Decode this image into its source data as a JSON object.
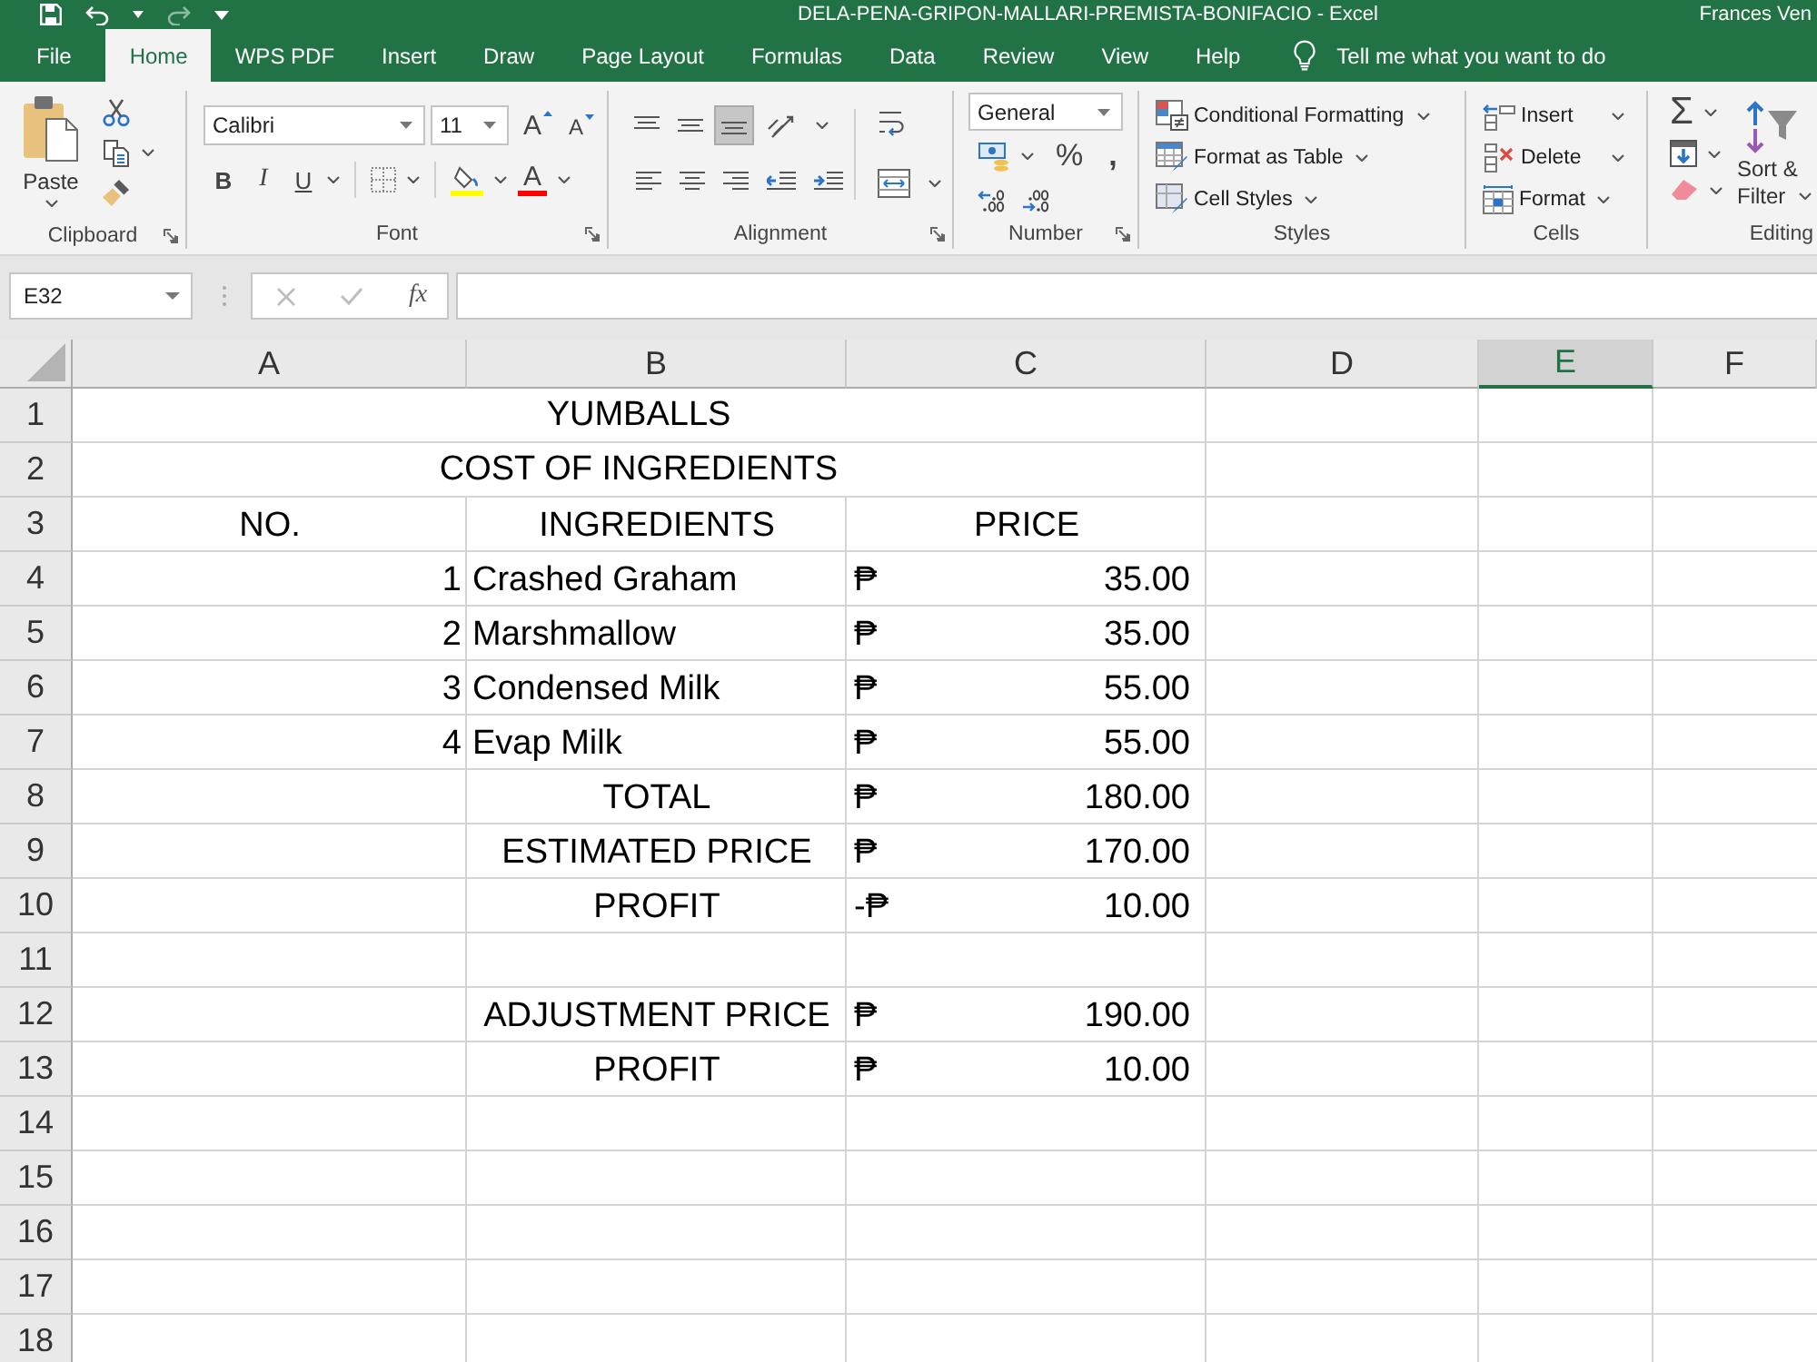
{
  "title_bar": {
    "title": "DELA-PENA-GRIPON-MALLARI-PREMISTA-BONIFACIO  -  Excel",
    "user": "Frances Ven"
  },
  "tabs": [
    {
      "label": "File",
      "selected": false
    },
    {
      "label": "Home",
      "selected": true
    },
    {
      "label": "WPS PDF",
      "selected": false
    },
    {
      "label": "Insert",
      "selected": false
    },
    {
      "label": "Draw",
      "selected": false
    },
    {
      "label": "Page Layout",
      "selected": false
    },
    {
      "label": "Formulas",
      "selected": false
    },
    {
      "label": "Data",
      "selected": false
    },
    {
      "label": "Review",
      "selected": false
    },
    {
      "label": "View",
      "selected": false
    },
    {
      "label": "Help",
      "selected": false
    }
  ],
  "tell_me": "Tell me what you want to do",
  "ribbon": {
    "clipboard": {
      "label": "Clipboard",
      "paste": "Paste"
    },
    "font": {
      "label": "Font",
      "font_name": "Calibri",
      "font_size": "11",
      "grow": "A",
      "shrink": "A",
      "bold": "B",
      "italic": "I",
      "underline": "U",
      "font_color": "A"
    },
    "alignment": {
      "label": "Alignment",
      "vertical": [
        {
          "kind": "top",
          "selected": false
        },
        {
          "kind": "middle",
          "selected": false
        },
        {
          "kind": "bottom",
          "selected": true
        }
      ]
    },
    "number": {
      "label": "Number",
      "format": "General",
      "percent": "%",
      "comma": ","
    },
    "styles": {
      "label": "Styles",
      "items": [
        {
          "kind": "conditional",
          "label": "Conditional Formatting"
        },
        {
          "kind": "table",
          "label": "Format as Table"
        },
        {
          "kind": "cell_styles",
          "label": "Cell Styles"
        }
      ]
    },
    "cells": {
      "label": "Cells",
      "items": [
        {
          "kind": "insert",
          "label": "Insert"
        },
        {
          "kind": "delete",
          "label": "Delete"
        },
        {
          "kind": "format",
          "label": "Format"
        }
      ]
    },
    "editing": {
      "label": "Editing",
      "autosum": "Σ",
      "sort_filter": [
        "Sort &",
        "Filter"
      ]
    }
  },
  "formula_bar": {
    "name_box": "E32",
    "function": "fx"
  },
  "sheet": {
    "columns": [
      {
        "label": "A",
        "selected": false
      },
      {
        "label": "B",
        "selected": false
      },
      {
        "label": "C",
        "selected": false
      },
      {
        "label": "D",
        "selected": false
      },
      {
        "label": "E",
        "selected": true
      },
      {
        "label": "F",
        "selected": false
      }
    ],
    "rows": [
      {
        "number": "1",
        "kind": "title",
        "text": "YUMBALLS"
      },
      {
        "number": "2",
        "kind": "title",
        "text": "COST OF INGREDIENTS"
      },
      {
        "number": "3",
        "kind": "header",
        "a": "NO.",
        "b": "INGREDIENTS",
        "c": "PRICE"
      },
      {
        "number": "4",
        "kind": "item",
        "a": "1",
        "b": "Crashed Graham",
        "currency": "₱",
        "amount": "35.00"
      },
      {
        "number": "5",
        "kind": "item",
        "a": "2",
        "b": "Marshmallow",
        "currency": "₱",
        "amount": "35.00"
      },
      {
        "number": "6",
        "kind": "item",
        "a": "3",
        "b": "Condensed Milk",
        "currency": "₱",
        "amount": "55.00"
      },
      {
        "number": "7",
        "kind": "item",
        "a": "4",
        "b": "Evap Milk",
        "currency": "₱",
        "amount": "55.00"
      },
      {
        "number": "8",
        "kind": "summary",
        "b": "TOTAL",
        "currency": "₱",
        "amount": "180.00"
      },
      {
        "number": "9",
        "kind": "summary",
        "b": "ESTIMATED PRICE",
        "currency": "₱",
        "amount": "170.00"
      },
      {
        "number": "10",
        "kind": "summary",
        "b": "PROFIT",
        "currency": "-₱",
        "amount": "10.00"
      },
      {
        "number": "11",
        "kind": "empty"
      },
      {
        "number": "12",
        "kind": "summary",
        "b": "ADJUSTMENT PRICE",
        "currency": "₱",
        "amount": "190.00"
      },
      {
        "number": "13",
        "kind": "summary",
        "b": "PROFIT",
        "currency": "₱",
        "amount": "10.00"
      },
      {
        "number": "14",
        "kind": "empty"
      },
      {
        "number": "15",
        "kind": "empty"
      },
      {
        "number": "16",
        "kind": "empty"
      },
      {
        "number": "17",
        "kind": "empty"
      },
      {
        "number": "18",
        "kind": "empty"
      }
    ]
  }
}
